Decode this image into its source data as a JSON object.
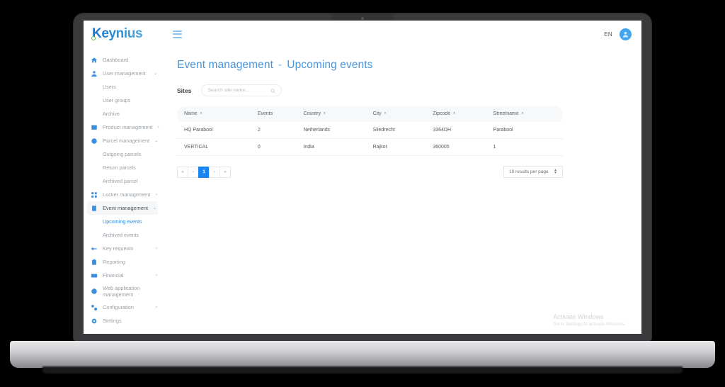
{
  "brand": {
    "name": "Keynius",
    "logo_dot": "green-circle-accent"
  },
  "header": {
    "menu_icon": "hamburger-icon",
    "language": "EN",
    "avatar_icon": "user-avatar-icon"
  },
  "sidebar": {
    "items": [
      {
        "label": "Dashboard",
        "icon": "home-icon",
        "type": "item",
        "chevron": "",
        "active": false
      },
      {
        "label": "User management",
        "icon": "user-icon",
        "type": "item",
        "chevron": "⌄",
        "active": false
      },
      {
        "label": "Users",
        "icon": "",
        "type": "sub",
        "chevron": "",
        "active": false
      },
      {
        "label": "User groups",
        "icon": "",
        "type": "sub",
        "chevron": "",
        "active": false
      },
      {
        "label": "Archive",
        "icon": "",
        "type": "sub",
        "chevron": "",
        "active": false
      },
      {
        "label": "Product management",
        "icon": "box-icon",
        "type": "item",
        "chevron": "›",
        "active": false
      },
      {
        "label": "Parcel management",
        "icon": "globe-icon",
        "type": "item",
        "chevron": "⌄",
        "active": false
      },
      {
        "label": "Outgoing parcels",
        "icon": "",
        "type": "sub",
        "chevron": "",
        "active": false
      },
      {
        "label": "Return parcels",
        "icon": "",
        "type": "sub",
        "chevron": "",
        "active": false
      },
      {
        "label": "Archived parcel",
        "icon": "",
        "type": "sub",
        "chevron": "",
        "active": false
      },
      {
        "label": "Locker management",
        "icon": "grid-icon",
        "type": "item",
        "chevron": "›",
        "active": false
      },
      {
        "label": "Event management",
        "icon": "calendar-icon",
        "type": "item",
        "chevron": "⌄",
        "active": true
      },
      {
        "label": "Upcoming events",
        "icon": "",
        "type": "sub",
        "chevron": "",
        "active": true
      },
      {
        "label": "Archived events",
        "icon": "",
        "type": "sub",
        "chevron": "",
        "active": false
      },
      {
        "label": "Key requests",
        "icon": "key-icon",
        "type": "item",
        "chevron": "›",
        "active": false
      },
      {
        "label": "Reporting",
        "icon": "clipboard-icon",
        "type": "item",
        "chevron": "",
        "active": false
      },
      {
        "label": "Financial",
        "icon": "money-icon",
        "type": "item",
        "chevron": "›",
        "active": false
      },
      {
        "label": "Web application management",
        "icon": "web-icon",
        "type": "item-2line",
        "chevron": "",
        "active": false
      },
      {
        "label": "Configuration",
        "icon": "config-icon",
        "type": "item",
        "chevron": "›",
        "active": false
      },
      {
        "label": "Settings",
        "icon": "gear-icon",
        "type": "item",
        "chevron": "",
        "active": false
      }
    ]
  },
  "main": {
    "title_primary": "Event management",
    "title_separator": "-",
    "title_secondary": "Upcoming events",
    "sites_label": "Sites",
    "search_placeholder": "Search site name...",
    "search_value": "",
    "search_icon": "search-icon"
  },
  "table": {
    "columns": [
      {
        "label": "Name",
        "sortable": true
      },
      {
        "label": "Events",
        "sortable": false
      },
      {
        "label": "Country",
        "sortable": true
      },
      {
        "label": "City",
        "sortable": true
      },
      {
        "label": "Zipcode",
        "sortable": true
      },
      {
        "label": "Streetname",
        "sortable": true
      }
    ],
    "sort_caret": "▾",
    "rows": [
      {
        "name": "HQ Parabool",
        "events": "2",
        "country": "Netherlands",
        "city": "Sliedrecht",
        "zipcode": "3364DH",
        "streetname": "Parabool"
      },
      {
        "name": "VERTICAL",
        "events": "0",
        "country": "India",
        "city": "Rajkot",
        "zipcode": "360005",
        "streetname": "1"
      }
    ]
  },
  "pagination": {
    "first": "«",
    "prev": "‹",
    "current_page": "1",
    "next": "›",
    "last": "»",
    "results_per_page": "10 results per page",
    "stepper_icon": "stepper-icon"
  },
  "watermark": {
    "line1": "Activate Windows",
    "line2": "Go to Settings to activate Windows."
  },
  "colors": {
    "accent_blue": "#1a84f5",
    "title_blue": "#4a94d8",
    "icon_blue": "#3d8ede",
    "logo_green": "#5dbb47"
  }
}
